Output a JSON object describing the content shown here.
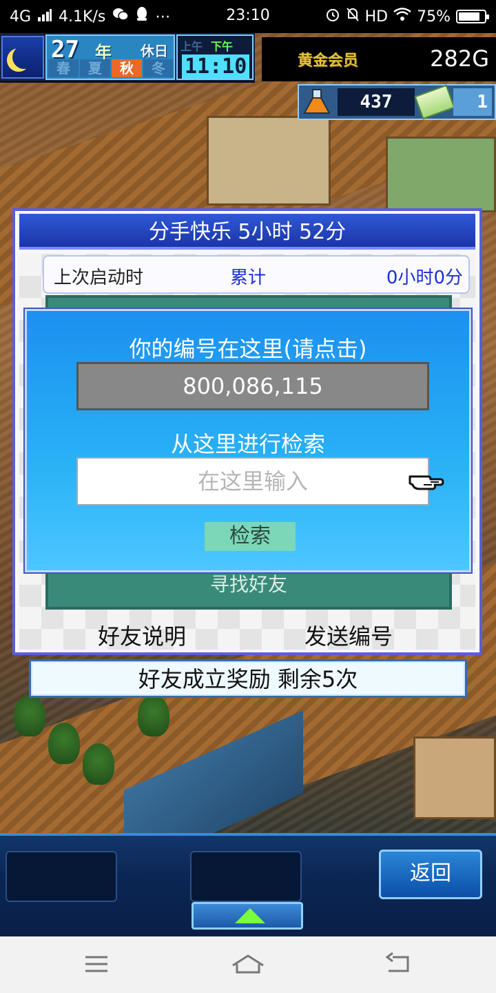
{
  "status_bar": {
    "network": "4G",
    "speed": "4.1K/s",
    "time": "23:10",
    "hd": "HD",
    "battery": "75%"
  },
  "hud": {
    "year": "27",
    "year_unit": "年",
    "holiday": "休日",
    "seasons": [
      "春",
      "夏",
      "秋",
      "冬"
    ],
    "active_season": "秋",
    "am": "上午",
    "pm": "下午",
    "clock": "11:10",
    "vip_label": "黄金会员",
    "gold": "282G",
    "research_points": "437",
    "tickets": "1"
  },
  "dialog": {
    "title": "分手快乐  5小时 52分",
    "stat_label": "上次启动时",
    "stat_total_label": "累计",
    "stat_value": "0小时0分",
    "find_friends_label": "寻找好友",
    "friend_info_label": "好友说明",
    "send_id_label": "发送编号"
  },
  "reward_bar": {
    "text": "好友成立奖励  剩余5次"
  },
  "search_modal": {
    "heading": "你的编号在这里(请点击)",
    "id_value": "800,086,115",
    "subheading": "从这里进行检索",
    "input_placeholder": "在这里输入",
    "search_button": "检索"
  },
  "game_nav": {
    "back_label": "返回"
  },
  "colors": {
    "modal_blue": "#1b90f0",
    "dialog_title_blue": "#1b35a8",
    "accent_link_blue": "#1b2fd8",
    "panel_green": "#3a8a7a",
    "search_button_green": "#7cd6b8"
  }
}
